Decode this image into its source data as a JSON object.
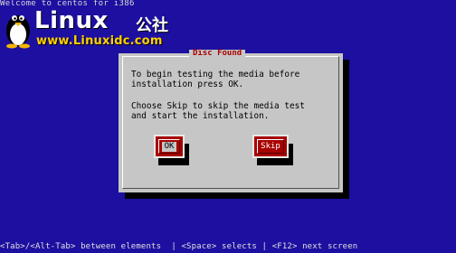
{
  "screen": {
    "top_text": "Welcome to centos for i386",
    "status_text": "<Tab>/<Alt-Tab> between elements  | <Space> selects | <F12> next screen"
  },
  "watermark": {
    "brand": "Linux",
    "brand_cn": "公社",
    "url": "www.Linuxidc.com"
  },
  "dialog": {
    "title": "Disc Found",
    "message_1": "To begin testing the media before\ninstallation press OK.",
    "message_2": "Choose Skip to skip the media test\nand start the installation.",
    "ok_label": "OK",
    "skip_label": "Skip",
    "focused_button": "OK"
  },
  "colors": {
    "background": "#1d0fa0",
    "dialog": "#c6c6c6",
    "title": "#a80000",
    "button": "#a80000",
    "url": "#ffd000"
  }
}
